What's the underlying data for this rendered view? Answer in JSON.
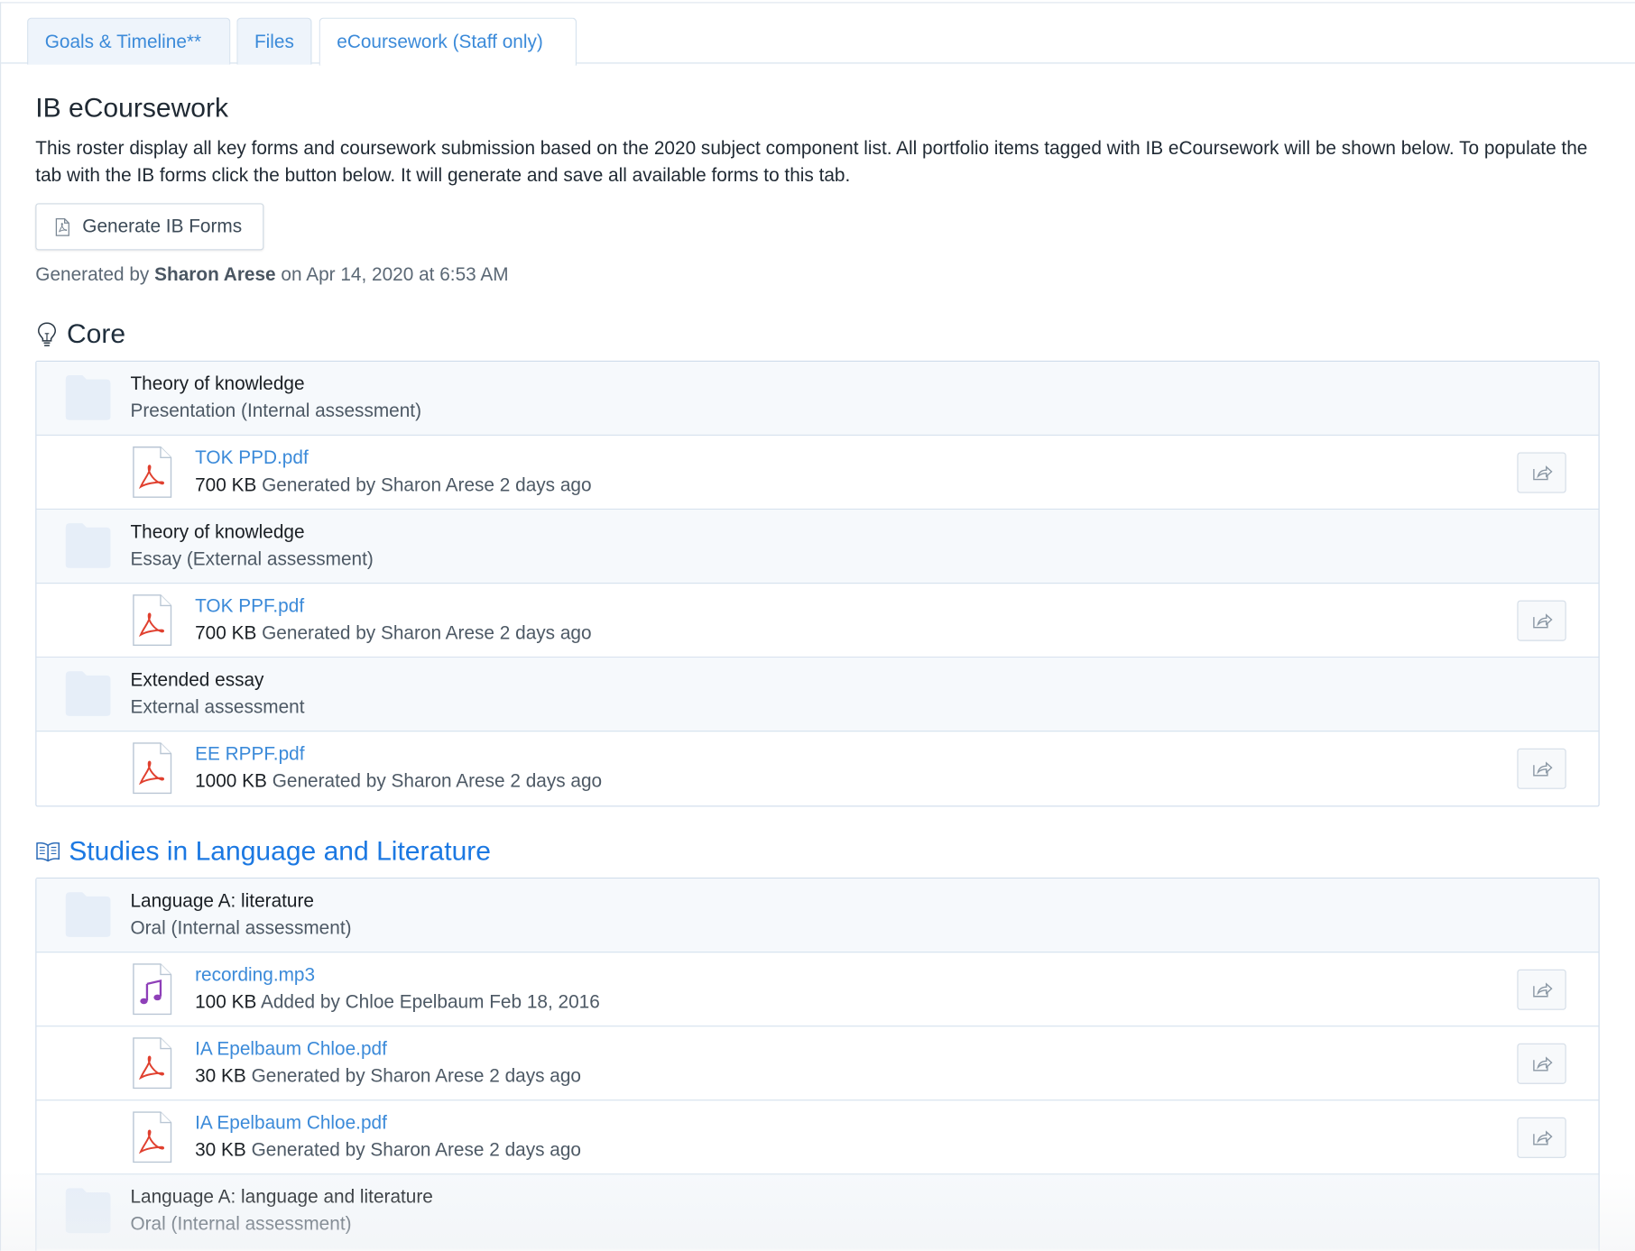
{
  "tabs": [
    {
      "label": "Goals & Timeline**",
      "active": false
    },
    {
      "label": "Files",
      "active": false
    },
    {
      "label": "eCoursework (Staff only)",
      "active": true
    }
  ],
  "page": {
    "title": "IB eCoursework",
    "description": "This roster display all key forms and coursework submission based on the 2020 subject component list. All portfolio items tagged with IB eCoursework will be shown below. To populate the tab with the IB forms click the button below. It will generate and save all available forms to this tab.",
    "generate_button_label": "Generate IB Forms",
    "generated_prefix": "Generated by",
    "generated_by": "Sharon Arese",
    "generated_suffix": "on Apr 14, 2020 at 6:53 AM"
  },
  "sections": [
    {
      "title": "Core",
      "icon": "lightbulb-icon",
      "color": "#1f2e3c",
      "groups": [
        {
          "title": "Theory of knowledge",
          "subtitle": "Presentation (Internal assessment)",
          "files": [
            {
              "name": "TOK PPD.pdf",
              "icon": "pdf-icon",
              "size": "700 KB",
              "meta": "Generated by Sharon Arese 2 days ago"
            }
          ]
        },
        {
          "title": "Theory of knowledge",
          "subtitle": "Essay (External assessment)",
          "files": [
            {
              "name": "TOK PPF.pdf",
              "icon": "pdf-icon",
              "size": "700 KB",
              "meta": "Generated by Sharon Arese 2 days ago"
            }
          ]
        },
        {
          "title": "Extended essay",
          "subtitle": "External assessment",
          "files": [
            {
              "name": "EE RPPF.pdf",
              "icon": "pdf-icon",
              "size": "1000 KB",
              "meta": "Generated by Sharon Arese 2 days ago"
            }
          ]
        }
      ]
    },
    {
      "title": "Studies in Language and Literature",
      "icon": "open-book-icon",
      "color": "#1b78e2",
      "groups": [
        {
          "title": "Language A: literature",
          "subtitle": "Oral (Internal assessment)",
          "files": [
            {
              "name": "recording.mp3",
              "icon": "audio-file-icon",
              "size": "100 KB",
              "meta": "Added by Chloe Epelbaum Feb 18, 2016"
            },
            {
              "name": "IA Epelbaum Chloe.pdf",
              "icon": "pdf-icon",
              "size": "30 KB",
              "meta": "Generated by Sharon Arese 2 days ago"
            },
            {
              "name": "IA Epelbaum Chloe.pdf",
              "icon": "pdf-icon",
              "size": "30 KB",
              "meta": "Generated by Sharon Arese 2 days ago"
            }
          ]
        },
        {
          "title": "Language A: language and literature",
          "subtitle": "Oral (Internal assessment)",
          "files": []
        }
      ]
    }
  ],
  "colors": {
    "link": "#3b8ad9",
    "pdf_red": "#e0402f",
    "audio_purple": "#8e3fb8",
    "folder_fill": "#e9f1fa"
  }
}
